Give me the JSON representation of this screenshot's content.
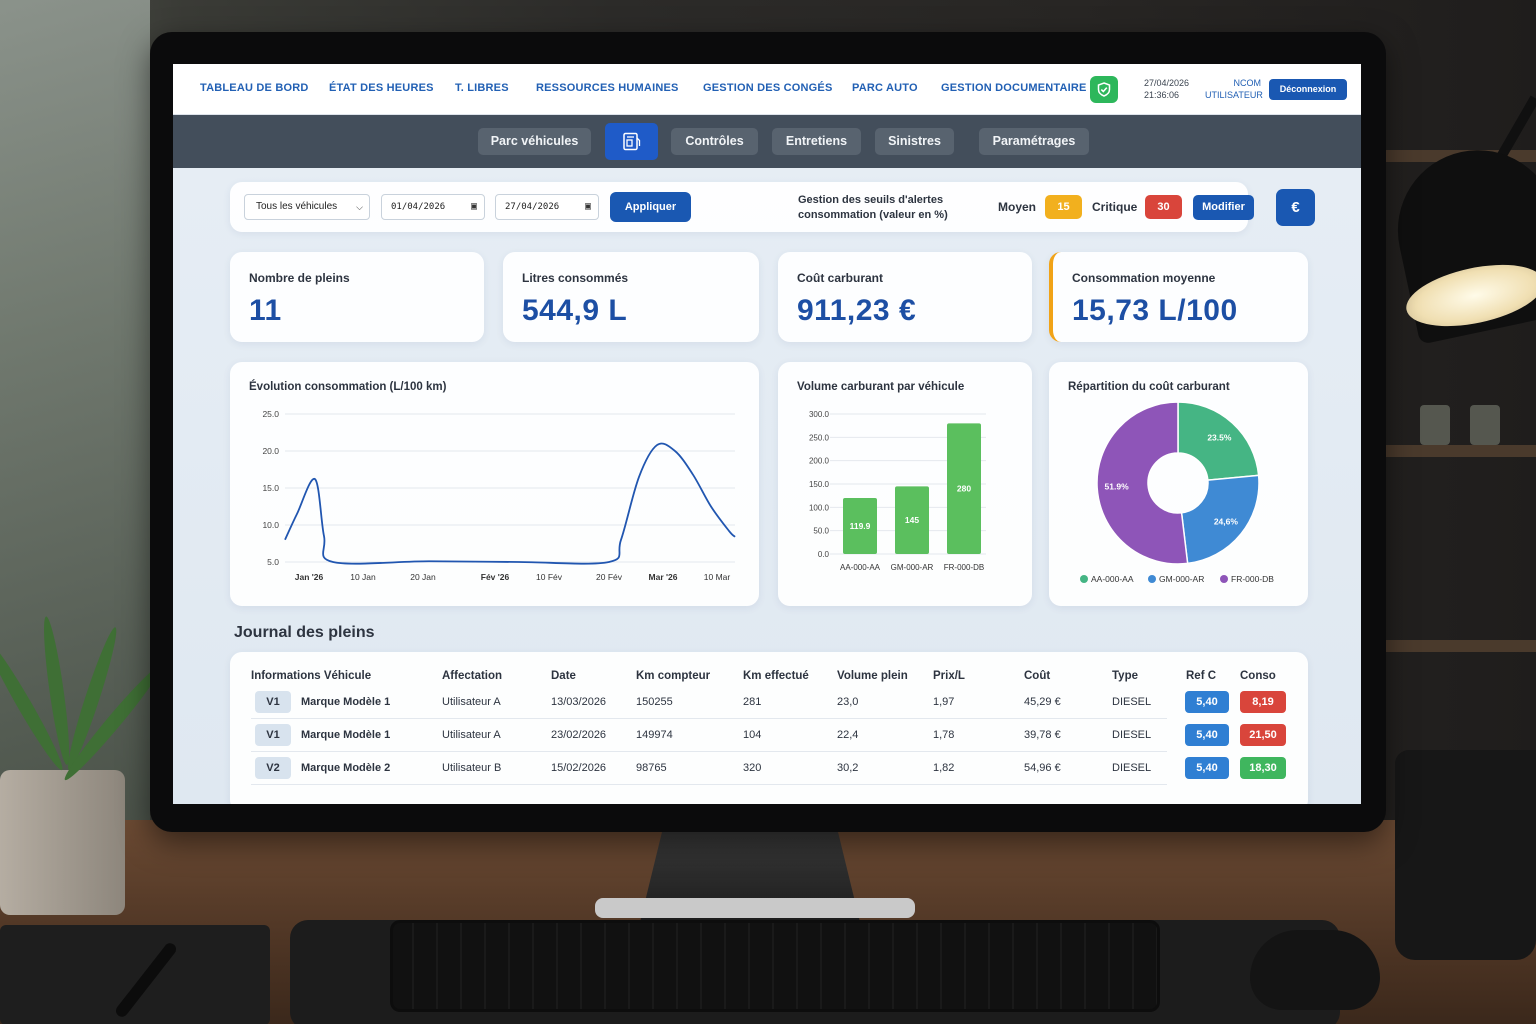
{
  "nav": {
    "items": [
      "TABLEAU DE BORD",
      "ÉTAT DES HEURES",
      "T. LIBRES",
      "RESSOURCES HUMAINES",
      "GESTION DES CONGÉS",
      "PARC AUTO",
      "GESTION DOCUMENTAIRE"
    ],
    "date": "27/04/2026",
    "time": "21:36:06",
    "user_name": "NCOM",
    "user_role": "UTILISATEUR",
    "logout_label": "Déconnexion",
    "status_icon": "check-shield-icon"
  },
  "subnav": {
    "items": [
      "Parc véhicules",
      "Contrôles",
      "Entretiens",
      "Sinistres",
      "Paramétrages"
    ],
    "active_icon": "fuel-document-icon"
  },
  "filters": {
    "vehicle_select": "Tous les véhicules",
    "date_from": "01/04/2026",
    "date_to": "27/04/2026",
    "apply_label": "Appliquer",
    "threshold_label": "Gestion des seuils d'alertes consommation (valeur en %)",
    "medium_label": "Moyen",
    "medium_value": "15",
    "critical_label": "Critique",
    "critical_value": "30",
    "modify_label": "Modifier",
    "currency_button": "€"
  },
  "kpis": [
    {
      "title": "Nombre de pleins",
      "value": "11"
    },
    {
      "title": "Litres consommés",
      "value": "544,9 L"
    },
    {
      "title": "Coût carburant",
      "value": "911,23 €"
    },
    {
      "title": "Consommation moyenne",
      "value": "15,73 L/100"
    }
  ],
  "charts": {
    "consumption_title": "Évolution consommation (L/100 km)",
    "volume_title": "Volume carburant par véhicule",
    "cost_title": "Répartition du coût carburant"
  },
  "chart_data": [
    {
      "type": "line",
      "title": "Évolution consommation (L/100 km)",
      "y_ticks": [
        "25.0",
        "20.0",
        "15.0",
        "10.0",
        "5.0"
      ],
      "ylim": [
        5,
        25
      ],
      "x_ticks": [
        "Jan '26",
        "10 Jan",
        "20 Jan",
        "Fév '26",
        "10 Fév",
        "20 Fév",
        "Mar '26",
        "10 Mar"
      ],
      "x_tick_days": [
        0,
        9,
        19,
        31,
        40,
        50,
        59,
        68
      ],
      "x_range_days": [
        -4,
        71
      ],
      "series": [
        {
          "color": "#2156b0",
          "points": [
            [
              -4,
              8.0
            ],
            [
              -2,
              11.5
            ],
            [
              1,
              16.2
            ],
            [
              2.5,
              8.5
            ],
            [
              4,
              5.0
            ],
            [
              20,
              5.1
            ],
            [
              35,
              5.0
            ],
            [
              50,
              5.0
            ],
            [
              52,
              8.0
            ],
            [
              55,
              16.5
            ],
            [
              58,
              20.8
            ],
            [
              61,
              20.0
            ],
            [
              64,
              16.8
            ],
            [
              67,
              12.5
            ],
            [
              70,
              9.2
            ],
            [
              71,
              8.4
            ]
          ]
        }
      ]
    },
    {
      "type": "bar",
      "title": "Volume carburant par véhicule",
      "categories": [
        "AA-000-AA",
        "GM-000-AR",
        "FR-000-DB"
      ],
      "values": [
        119.9,
        145,
        280
      ],
      "value_labels": [
        "119.9",
        "145",
        "280"
      ],
      "y_ticks": [
        "300.0",
        "250.0",
        "200.0",
        "150.0",
        "100.0",
        "50.0",
        "0.0"
      ],
      "ylim": [
        0,
        300
      ],
      "color": "#5bbf5e"
    },
    {
      "type": "pie",
      "title": "Répartition du coût carburant",
      "labels": [
        "AA-000-AA",
        "GM-000-AR",
        "FR-000-DB"
      ],
      "values": [
        23.5,
        24.6,
        51.9
      ],
      "value_labels": [
        "23.5%",
        "24,6%",
        "51.9%"
      ],
      "colors": [
        "#45b584",
        "#3f8ad4",
        "#8e55b8"
      ],
      "donut": true,
      "legend": "bottom"
    }
  ],
  "journal": {
    "title": "Journal des pleins",
    "columns": [
      "Informations Véhicule",
      "Affectation",
      "Date",
      "Km compteur",
      "Km effectué",
      "Volume plein",
      "Prix/L",
      "Coût",
      "Type",
      "Ref C",
      "Conso"
    ],
    "rows": [
      {
        "tag": "V1",
        "model": "Marque Modèle 1",
        "assignee": "Utilisateur A",
        "date": "13/03/2026",
        "odometer": "150255",
        "km": "281",
        "volume": "23,0",
        "price": "1,97",
        "cost": "45,29 €",
        "type": "DIESEL",
        "ref": "5,40",
        "conso": "8,19",
        "conso_color": "#d9453b"
      },
      {
        "tag": "V1",
        "model": "Marque Modèle 1",
        "assignee": "Utilisateur A",
        "date": "23/02/2026",
        "odometer": "149974",
        "km": "104",
        "volume": "22,4",
        "price": "1,78",
        "cost": "39,78 €",
        "type": "DIESEL",
        "ref": "5,40",
        "conso": "21,50",
        "conso_color": "#d9453b"
      },
      {
        "tag": "V2",
        "model": "Marque Modèle 2",
        "assignee": "Utilisateur B",
        "date": "15/02/2026",
        "odometer": "98765",
        "km": "320",
        "volume": "30,2",
        "price": "1,82",
        "cost": "54,96 €",
        "type": "DIESEL",
        "ref": "5,40",
        "conso": "18,30",
        "conso_color": "#3fb65e"
      }
    ]
  },
  "colors": {
    "primary": "#1a58b2",
    "medium_badge": "#f2b01e",
    "critical_badge": "#d9453b",
    "ref_pill": "#2f7fd3"
  }
}
